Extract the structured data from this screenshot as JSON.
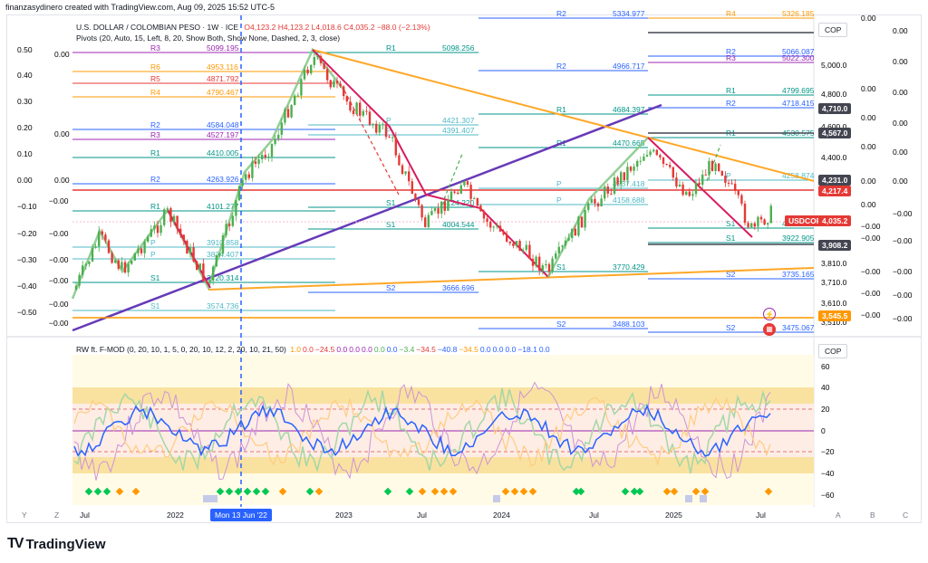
{
  "header": {
    "credit": "finanzasydinero created with TradingView.com, Aug 09, 2025 15:52 UTC-5"
  },
  "symbol": {
    "name": "U.S. DOLLAR / COLOMBIAN PESO · 1W · ICE",
    "open": "O4,123.2",
    "high": "H4,123.2",
    "low": "L4,018.6",
    "close": "C4,035.2",
    "change": "−88.0 (−2.13%)"
  },
  "indicators": {
    "pivots": "Pivots (20, Auto, 15, Left, 8, 20, Show Both, Show None, Dashed, 2, 3, close)",
    "rw_name": "RW ft. F-MOD (0, 20, 10, 1, 5, 0, 20, 10, 12, 2, 20, 10, 21, 50)",
    "rw_values": [
      {
        "t": "1.0",
        "c": "#ff9800"
      },
      {
        "t": "0.0",
        "c": "#e53935"
      },
      {
        "t": "−24.5",
        "c": "#e53935"
      },
      {
        "t": "0.0",
        "c": "#9c27b0"
      },
      {
        "t": "0.0",
        "c": "#9c27b0"
      },
      {
        "t": "0.0",
        "c": "#9c27b0"
      },
      {
        "t": "0.0",
        "c": "#4caf50"
      },
      {
        "t": "0.0",
        "c": "#2962ff"
      },
      {
        "t": "−3.4",
        "c": "#4caf50"
      },
      {
        "t": "−34.5",
        "c": "#e53935"
      },
      {
        "t": "−40.8",
        "c": "#2962ff"
      },
      {
        "t": "−34.5",
        "c": "#ff9800"
      },
      {
        "t": "0.0",
        "c": "#2962ff"
      },
      {
        "t": "0.0",
        "c": "#2962ff"
      },
      {
        "t": "0.0",
        "c": "#2962ff"
      },
      {
        "t": "−18.1",
        "c": "#2962ff"
      },
      {
        "t": "0.0",
        "c": "#2962ff"
      }
    ]
  },
  "currency_label": "COP",
  "currency_label_2": "COP",
  "price_scale": [
    "5,000.0",
    "4,800.0",
    "4,600.0",
    "4,400.0",
    "3,810.0",
    "3,710.0",
    "3,610.0",
    "3,510.0"
  ],
  "price_tags": [
    {
      "label": "4,710.0",
      "bg": "#434651"
    },
    {
      "label": "4,567.0",
      "bg": "#434651"
    },
    {
      "label": "4,231.0",
      "bg": "#434651"
    },
    {
      "label": "4,217.4",
      "bg": "#e53935"
    },
    {
      "label": "USDCOP",
      "bg": "#e53935"
    },
    {
      "label": "4,035.2",
      "bg": "#e53935"
    },
    {
      "label": "3,908.2",
      "bg": "#434651"
    },
    {
      "label": "3,545.5",
      "bg": "#ff9800"
    }
  ],
  "right_axis": [
    "0.00",
    "0.00",
    "0.00",
    "0.00",
    "0.00",
    "0.00",
    "−0.00",
    "−0.00",
    "−0.00",
    "−0.00",
    "−0.00"
  ],
  "inner_axis": [
    "0.00",
    "0.00",
    "0.00",
    "0.00",
    "0.00",
    "0.00",
    "0.00",
    "−0.00",
    "−0.00",
    "−0.00",
    "−0.00",
    "−0.00"
  ],
  "left_axis": [
    "0.50",
    "0.40",
    "0.30",
    "0.20",
    "0.10",
    "0.00",
    "−0.10",
    "−0.20",
    "−0.30",
    "−0.40",
    "−0.50"
  ],
  "left_axis_2": [
    "0.00",
    "0.00",
    "0.00",
    "0.00",
    "0.00",
    "−0.00",
    "−0.00",
    "−0.00",
    "−0.00",
    "−0.00",
    "−0.00"
  ],
  "osc_scale": [
    "60",
    "40",
    "20",
    "0",
    "−20",
    "−40",
    "−60"
  ],
  "pivot_labels": [
    {
      "lbl": "R3",
      "val": "5099.195",
      "c": "#9c27b0"
    },
    {
      "lbl": "R6",
      "val": "4953.116",
      "c": "#ff9800"
    },
    {
      "lbl": "R5",
      "val": "4871.792",
      "c": "#e53935"
    },
    {
      "lbl": "R4",
      "val": "4790.467",
      "c": "#ff9800"
    },
    {
      "lbl": "R2",
      "val": "4584.048",
      "c": "#2962ff"
    },
    {
      "lbl": "R3",
      "val": "4527.197",
      "c": "#9c27b0"
    },
    {
      "lbl": "R1",
      "val": "4410.005",
      "c": "#009688"
    },
    {
      "lbl": "R2",
      "val": "4263.926",
      "c": "#2962ff"
    },
    {
      "lbl": "R1",
      "val": "4101.277",
      "c": "#009688"
    },
    {
      "lbl": "P",
      "val": "3910.858",
      "c": "#4fb8c4"
    },
    {
      "lbl": "P",
      "val": "3834.407",
      "c": "#4fb8c4"
    },
    {
      "lbl": "S1",
      "val": "3720.314",
      "c": "#009688"
    },
    {
      "lbl": "S1",
      "val": "3574.736",
      "c": "#4fb8c4"
    },
    {
      "lbl": "R1",
      "val": "5098.256",
      "c": "#009688"
    },
    {
      "lbl": "P",
      "val": "4421.307",
      "c": "#4fb8c4"
    },
    {
      "lbl": "P",
      "val": "4391.407",
      "c": "#4fb8c4"
    },
    {
      "lbl": "S1",
      "val": "4124.220",
      "c": "#009688"
    },
    {
      "lbl": "S1",
      "val": "4004.544",
      "c": "#009688"
    },
    {
      "lbl": "S2",
      "val": "3666.696",
      "c": "#2962ff"
    },
    {
      "lbl": "R2",
      "val": "5334.977",
      "c": "#2962ff"
    },
    {
      "lbl": "R2",
      "val": "4966.717",
      "c": "#2962ff"
    },
    {
      "lbl": "R1",
      "val": "4684.397",
      "c": "#009688"
    },
    {
      "lbl": "R1",
      "val": "4470.665",
      "c": "#009688"
    },
    {
      "lbl": "P",
      "val": "4237.418",
      "c": "#4fb8c4"
    },
    {
      "lbl": "P",
      "val": "4158.688",
      "c": "#4fb8c4"
    },
    {
      "lbl": "S1",
      "val": "3770.429",
      "c": "#009688"
    },
    {
      "lbl": "S2",
      "val": "3488.103",
      "c": "#2962ff"
    },
    {
      "lbl": "R4",
      "val": "5326.185",
      "c": "#ff9800"
    },
    {
      "lbl": "R2",
      "val": "5066.087",
      "c": "#2962ff"
    },
    {
      "lbl": "R3",
      "val": "5022.300",
      "c": "#9c27b0"
    },
    {
      "lbl": "R1",
      "val": "4799.695",
      "c": "#009688"
    },
    {
      "lbl": "R2",
      "val": "4718.415",
      "c": "#2962ff"
    },
    {
      "lbl": "R1",
      "val": "4530.575",
      "c": "#009688"
    },
    {
      "lbl": "P",
      "val": "4258.874",
      "c": "#4fb8c4"
    },
    {
      "lbl": "S1",
      "val": "4004.185",
      "c": "#009688"
    },
    {
      "lbl": "S1",
      "val": "3922.905",
      "c": "#009688"
    },
    {
      "lbl": "S2",
      "val": "3735.165",
      "c": "#2962ff"
    },
    {
      "lbl": "S2",
      "val": "3475.067",
      "c": "#2962ff"
    }
  ],
  "time_axis": {
    "labels": [
      "Jul",
      "2022",
      "2023",
      "Jul",
      "2024",
      "Jul",
      "2025",
      "Jul"
    ],
    "current_date": "Mon 13 Jun '22",
    "scale_buttons": [
      "Y",
      "Z",
      "A",
      "B",
      "C"
    ]
  },
  "brand": {
    "name": "TradingView"
  },
  "colors": {
    "up": "#4caf50",
    "down": "#e53935",
    "accent": "#2962ff",
    "orange": "#ff9800",
    "purple": "#673ab7",
    "pink": "#e91e63"
  }
}
